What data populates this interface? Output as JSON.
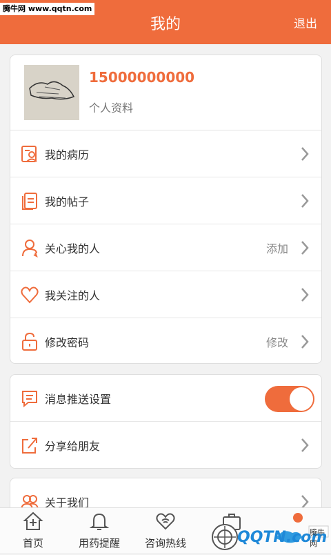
{
  "watermark": "腾牛网 www.qqtn.com",
  "header": {
    "title": "我的",
    "logout": "退出"
  },
  "profile": {
    "phone": "15000000000",
    "subtitle": "个人资料"
  },
  "menu1": [
    {
      "label": "我的病历",
      "icon": "medical-record-icon",
      "extra": ""
    },
    {
      "label": "我的帖子",
      "icon": "posts-icon",
      "extra": ""
    },
    {
      "label": "关心我的人",
      "icon": "person-icon",
      "extra": "添加"
    },
    {
      "label": "我关注的人",
      "icon": "heart-icon",
      "extra": ""
    },
    {
      "label": "修改密码",
      "icon": "lock-icon",
      "extra": "修改"
    }
  ],
  "menu2": [
    {
      "label": "消息推送设置",
      "icon": "message-icon",
      "toggle_on": true
    },
    {
      "label": "分享给朋友",
      "icon": "share-icon"
    }
  ],
  "menu3": [
    {
      "label": "关于我们",
      "icon": "group-icon"
    }
  ],
  "tabs": [
    {
      "label": "首页",
      "icon": "home-icon"
    },
    {
      "label": "用药提醒",
      "icon": "bell-icon"
    },
    {
      "label": "咨询热线",
      "icon": "hotline-icon"
    },
    {
      "label": "",
      "icon": "medkit-icon"
    },
    {
      "label": "",
      "icon": "profile-icon"
    }
  ],
  "qqtn_logo": "QQTN.com",
  "qqtn_badge": "腾牛网",
  "colors": {
    "accent": "#ef6c3c",
    "background": "#f2f2f2"
  }
}
